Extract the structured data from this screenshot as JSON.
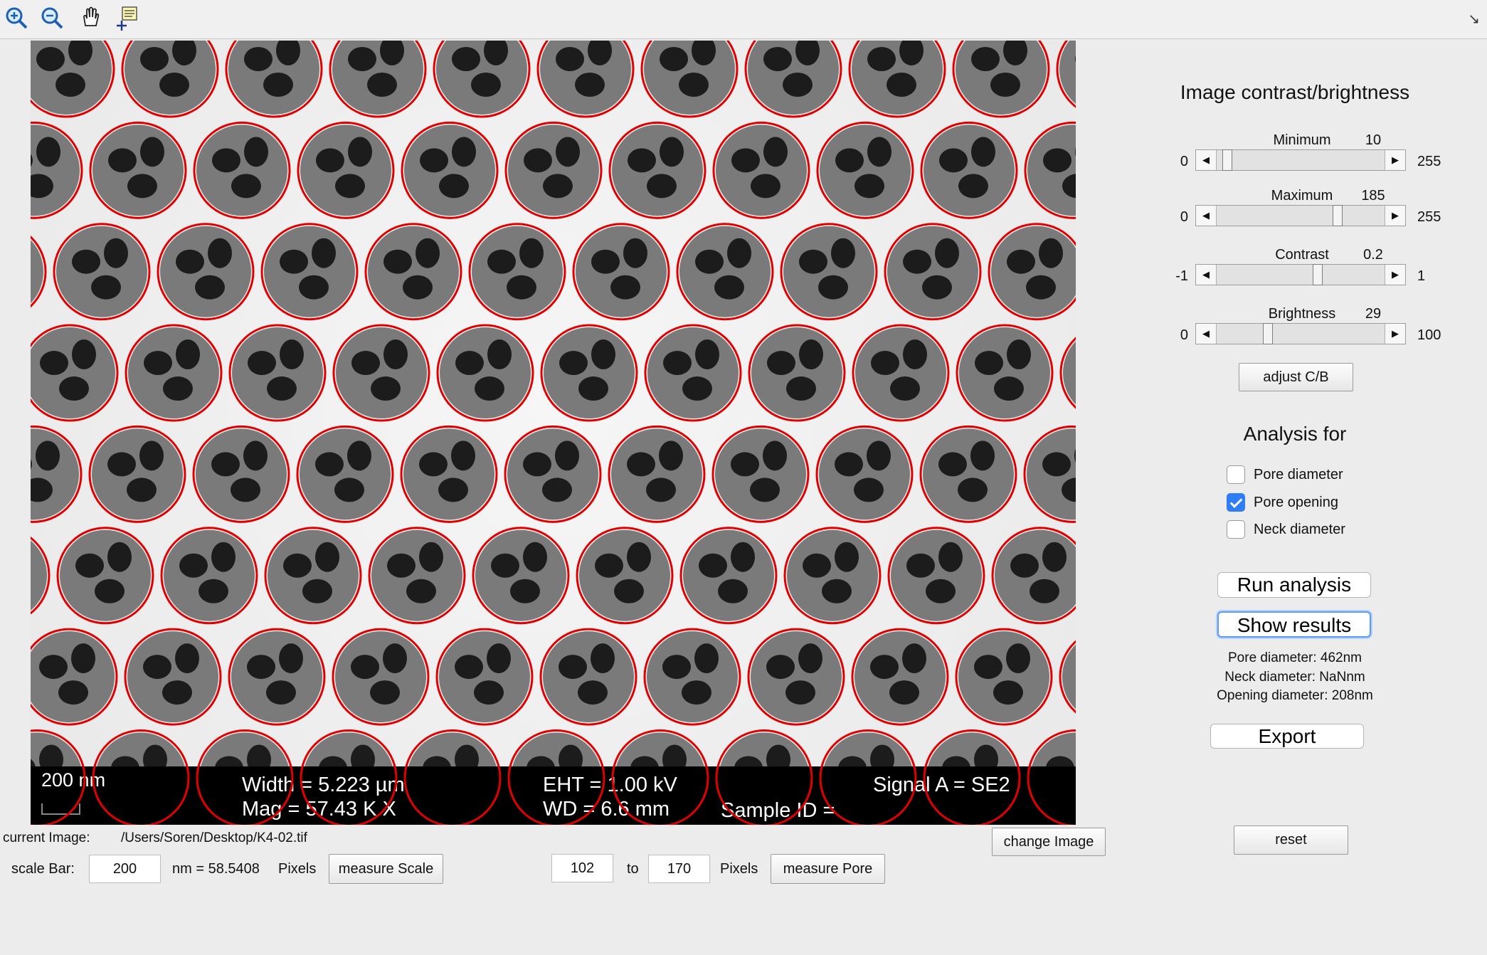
{
  "toolbar": {
    "zoom_in": "zoom-in-icon",
    "zoom_out": "zoom-out-icon",
    "pan": "pan-hand-icon",
    "data_cursor": "data-cursor-icon",
    "corner": "↘"
  },
  "image": {
    "databar": {
      "scale": "200 nm",
      "width": "Width = 5.223 µm",
      "mag": "Mag =  57.43 K X",
      "eht": "EHT =  1.00 kV",
      "wd": "WD =  6.6 mm",
      "sample_id": "Sample ID =",
      "signal": "Signal A = SE2"
    },
    "circle_color": "#e00000"
  },
  "bottom": {
    "current_image_label": "current Image:",
    "current_image_path": "/Users/Soren/Desktop/K4-02.tif",
    "change_image": "change Image",
    "scale_bar_label": "scale Bar:",
    "scale_bar_value": "200",
    "nm_equals": "nm = 58.5408",
    "pixels_label_1": "Pixels",
    "measure_scale": "measure Scale",
    "pore_min": "102",
    "to_label": "to",
    "pore_max": "170",
    "pixels_label_2": "Pixels",
    "measure_pore": "measure Pore"
  },
  "panel": {
    "cb_title": "Image contrast/brightness",
    "sliders": [
      {
        "name": "Minimum",
        "value": "10",
        "min": "0",
        "max": "255",
        "frac": 0.04
      },
      {
        "name": "Maximum",
        "value": "185",
        "min": "0",
        "max": "255",
        "frac": 0.725
      },
      {
        "name": "Contrast",
        "value": "0.2",
        "min": "-1",
        "max": "1",
        "frac": 0.6
      },
      {
        "name": "Brightness",
        "value": "29",
        "min": "0",
        "max": "100",
        "frac": 0.29
      }
    ],
    "adjust": "adjust C/B",
    "analysis_title": "Analysis for",
    "checks": [
      {
        "label": "Pore diameter",
        "checked": false
      },
      {
        "label": "Pore opening",
        "checked": true
      },
      {
        "label": "Neck diameter",
        "checked": false
      }
    ],
    "run": "Run analysis",
    "show": "Show results",
    "results": {
      "pore": "Pore diameter: 462nm",
      "neck": "Neck diameter: NaNnm",
      "opening": "Opening diameter: 208nm"
    },
    "export": "Export",
    "reset": "reset"
  }
}
